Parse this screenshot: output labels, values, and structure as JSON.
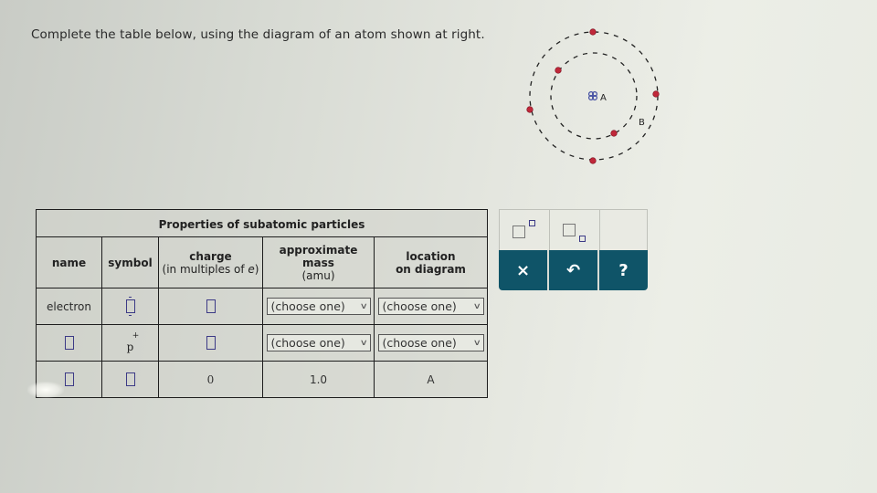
{
  "instruction": "Complete the table below, using the diagram of an atom shown at right.",
  "diagram": {
    "labels": {
      "nucleus": "A",
      "orbit": "B"
    },
    "colors": {
      "electron": "#c0283a",
      "nucleus": "#3e4aa0",
      "orbit_line": "#222222"
    }
  },
  "table": {
    "caption": "Properties of subatomic particles",
    "headers": {
      "name": "name",
      "symbol": "symbol",
      "charge": "charge",
      "charge_sub_prefix": "(in multiples of ",
      "charge_sub_var": "e",
      "charge_sub_suffix": ")",
      "mass": "approximate mass",
      "mass_line1": "approximate",
      "mass_line2": "mass",
      "mass_sub": "(amu)",
      "location_line1": "location",
      "location_line2": "on diagram"
    },
    "rows": [
      {
        "name": "electron",
        "symbol": "",
        "charge": "",
        "mass": "(choose one)",
        "location": "(choose one)"
      },
      {
        "name": "",
        "symbol": "p",
        "symbol_sup": "+",
        "charge": "",
        "mass": "(choose one)",
        "location": "(choose one)"
      },
      {
        "name": "",
        "symbol": "",
        "charge": "0",
        "mass": "1.0",
        "location": "A"
      }
    ]
  },
  "toolbar": {
    "superscript_icon": "superscript-icon",
    "subscript_icon": "subscript-icon",
    "clear_label": "×",
    "undo_label": "↶",
    "help_label": "?",
    "accent_color": "#0f5468"
  }
}
